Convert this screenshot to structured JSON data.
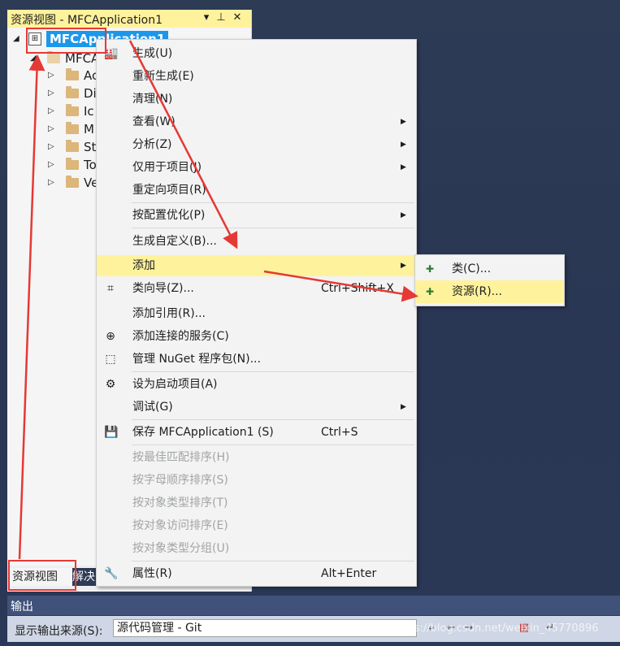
{
  "panel": {
    "title": "资源视图 - MFCApplication1",
    "pin_glyph": "▾",
    "pin2_glyph": "⊥",
    "close_glyph": "✕"
  },
  "tree": {
    "root_label": "MFCApplication1",
    "sub_label": "MFCA",
    "children": [
      "Ac",
      "Di",
      "Ic",
      "M",
      "St",
      "To",
      "Ve"
    ]
  },
  "panel_tabs": {
    "resview": "资源视图",
    "solution": "解决"
  },
  "menu": {
    "items": [
      {
        "label": "生成(U)",
        "icon": "build-icon"
      },
      {
        "label": "重新生成(E)"
      },
      {
        "label": "清理(N)"
      },
      {
        "label": "查看(W)",
        "submenu": true
      },
      {
        "label": "分析(Z)",
        "submenu": true
      },
      {
        "label": "仅用于项目(J)",
        "submenu": true
      },
      {
        "label": "重定向项目(R)"
      },
      {
        "label": "按配置优化(P)",
        "submenu": true
      },
      {
        "label": "生成自定义(B)..."
      },
      {
        "label": "添加",
        "submenu": true
      },
      {
        "label": "类向导(Z)...",
        "shortcut": "Ctrl+Shift+X"
      },
      {
        "label": "添加引用(R)..."
      },
      {
        "label": "添加连接的服务(C)"
      },
      {
        "label": "管理 NuGet 程序包(N)..."
      },
      {
        "label": "设为启动项目(A)"
      },
      {
        "label": "调试(G)",
        "submenu": true
      },
      {
        "label": "保存 MFCApplication1 (S)",
        "shortcut": "Ctrl+S"
      },
      {
        "label": "按最佳匹配排序(H)"
      },
      {
        "label": "按字母顺序排序(S)"
      },
      {
        "label": "按对象类型排序(T)"
      },
      {
        "label": "按对象访问排序(E)"
      },
      {
        "label": "按对象类型分组(U)"
      },
      {
        "label": "属性(R)",
        "shortcut": "Alt+Enter"
      }
    ],
    "submenu_arrow": "▶"
  },
  "submenu": {
    "items": [
      "类(C)...",
      "资源(R)..."
    ]
  },
  "output": {
    "title": "输出",
    "source_label": "显示输出来源(S):",
    "source_value": "源代码管理 - Git"
  },
  "watermark": "https://blog.csdn.net/weixin_45770896",
  "colors": {
    "highlight": "#fff29d",
    "selection": "#1c97ea",
    "annotation": "#e53935"
  }
}
